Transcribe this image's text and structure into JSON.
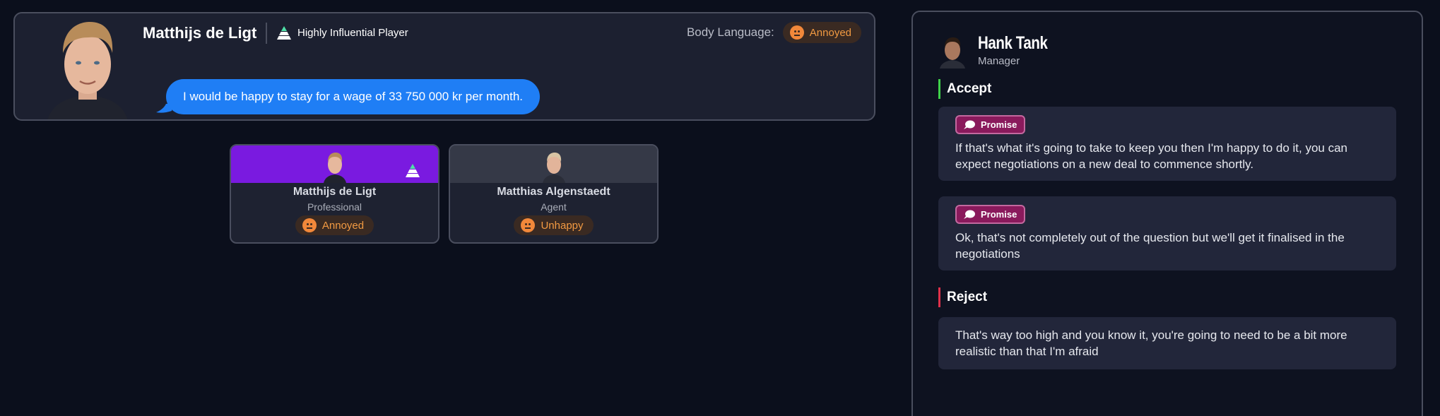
{
  "player": {
    "name": "Matthijs de Ligt",
    "influence_label": "Highly Influential Player",
    "body_language_label": "Body Language:",
    "body_language_value": "Annoyed",
    "speech": "I would be happy to stay for a wage of 33 750 000 kr per month."
  },
  "participants": [
    {
      "name": "Matthijs de Ligt",
      "role": "Professional",
      "mood": "Annoyed"
    },
    {
      "name": "Matthias Algenstaedt",
      "role": "Agent",
      "mood": "Unhappy"
    }
  ],
  "manager": {
    "name": "Hank Tank",
    "role": "Manager"
  },
  "sections": {
    "accept": {
      "heading": "Accept",
      "options": [
        {
          "tag": "Promise",
          "text": "If that's what it's going to take to keep you then I'm happy to do it, you can expect negotiations on a new deal to commence shortly."
        },
        {
          "tag": "Promise",
          "text": "Ok, that's not completely out of the question but we'll get it finalised in the negotiations"
        }
      ]
    },
    "reject": {
      "heading": "Reject",
      "options": [
        {
          "text": "That's way too high and you know it, you're going to need to be a bit more realistic than that I'm afraid"
        }
      ]
    }
  },
  "colors": {
    "accent_blue": "#1f7ef5",
    "influential_purple": "#7a1ae0",
    "accept_green": "#3fd14a",
    "reject_red": "#e0304a",
    "mood_orange": "#f29a42",
    "promise_magenta": "#8a1a5c"
  },
  "icons": {
    "influence": "pyramid-icon",
    "mood": "annoyed-face-icon",
    "promise": "speech-bubble-icon"
  }
}
